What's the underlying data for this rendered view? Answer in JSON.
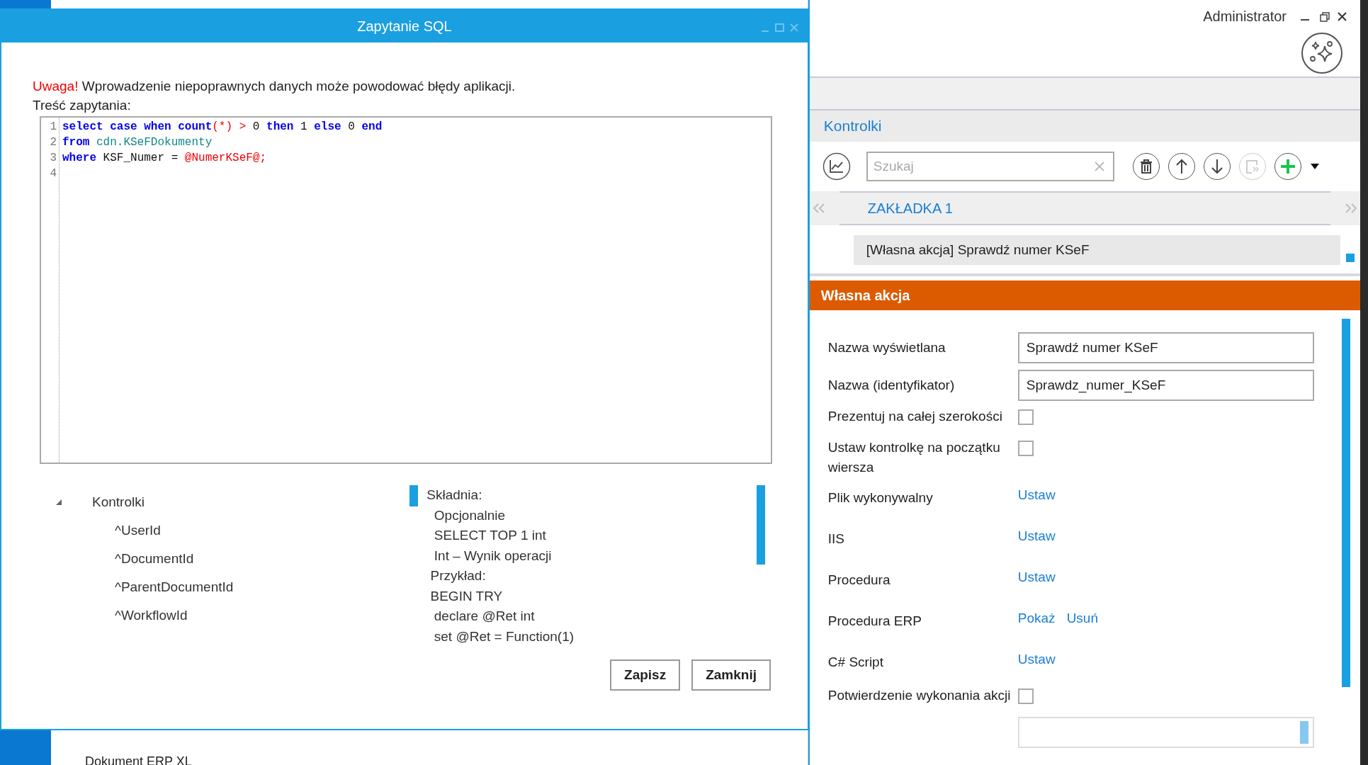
{
  "app": {
    "user": "Administrator",
    "section_title": "Kontrolki",
    "search": {
      "placeholder": "Szukaj"
    },
    "toolbar": [
      {
        "kind": "delete",
        "disabled": false
      },
      {
        "kind": "up",
        "disabled": false
      },
      {
        "kind": "down",
        "disabled": false
      },
      {
        "kind": "copy",
        "disabled": true
      },
      {
        "kind": "add",
        "disabled": false
      }
    ],
    "tabs": [
      {
        "label": "ZAKŁADKA 1",
        "selected": true
      }
    ],
    "list_items": [
      {
        "label": "[Własna akcja] Sprawdź numer KSeF",
        "selected": true
      }
    ],
    "panel_title": "Własna akcja",
    "fields": [
      {
        "kind": "text",
        "label": "Nazwa wyświetlana",
        "value": "Sprawdź numer KSeF"
      },
      {
        "kind": "text",
        "label": "Nazwa (identyfikator)",
        "value": "Sprawdz_numer_KSeF"
      },
      {
        "kind": "checkbox",
        "label": "Prezentuj na całej szerokości",
        "checked": false
      },
      {
        "kind": "checkbox",
        "label": "Ustaw kontrolkę na początku wiersza",
        "checked": false
      },
      {
        "kind": "links",
        "label": "Plik wykonywalny",
        "links": [
          "Ustaw"
        ]
      },
      {
        "kind": "links",
        "label": "IIS",
        "links": [
          "Ustaw"
        ]
      },
      {
        "kind": "links",
        "label": "Procedura",
        "links": [
          "Ustaw"
        ]
      },
      {
        "kind": "links",
        "label": "Procedura ERP",
        "links": [
          "Pokaż",
          "Usuń"
        ]
      },
      {
        "kind": "links",
        "label": "C# Script",
        "links": [
          "Ustaw"
        ]
      },
      {
        "kind": "checkbox",
        "label": "Potwierdzenie wykonania akcji",
        "checked": false
      },
      {
        "kind": "memo"
      }
    ],
    "status_text": "Dokument ERP XL"
  },
  "dialog": {
    "title": "Zapytanie SQL",
    "warning_prefix": "Uwaga!",
    "warning": "Wprowadzenie niepoprawnych danych może powodować błędy aplikacji.",
    "query_label": "Treść zapytania:",
    "code_lines": [
      {
        "number": "1",
        "tokens": [
          {
            "kind": "keyword",
            "text": "select case when count"
          },
          {
            "kind": "operator",
            "text": "(*) > "
          },
          {
            "kind": "plain",
            "text": "0 "
          },
          {
            "kind": "keyword",
            "text": "then"
          },
          {
            "kind": "plain",
            "text": " 1 "
          },
          {
            "kind": "keyword",
            "text": "else"
          },
          {
            "kind": "plain",
            "text": " 0 "
          },
          {
            "kind": "keyword",
            "text": "end"
          }
        ]
      },
      {
        "number": "2",
        "tokens": [
          {
            "kind": "keyword",
            "text": "from"
          },
          {
            "kind": "object",
            "text": " cdn.KSeFDokumenty"
          }
        ]
      },
      {
        "number": "3",
        "tokens": [
          {
            "kind": "keyword",
            "text": "where"
          },
          {
            "kind": "plain",
            "text": " KSF_Numer = "
          },
          {
            "kind": "variable",
            "text": "@NumerKSeF@;"
          }
        ]
      },
      {
        "number": "4"
      }
    ],
    "tree": {
      "label": "Kontrolki",
      "expanded": true,
      "children": [
        {
          "label": "^UserId"
        },
        {
          "label": "^DocumentId"
        },
        {
          "label": "^ParentDocumentId"
        },
        {
          "label": "^WorkflowId"
        }
      ]
    },
    "syntax_lines": [
      "Składnia:",
      "  Opcjonalnie",
      "  SELECT TOP 1 int",
      "  Int – Wynik operacji",
      " Przykład:",
      " BEGIN TRY",
      "  declare @Ret int",
      "  set @Ret = Function(1)"
    ],
    "buttons": [
      "Zapisz",
      "Zamknij"
    ]
  }
}
